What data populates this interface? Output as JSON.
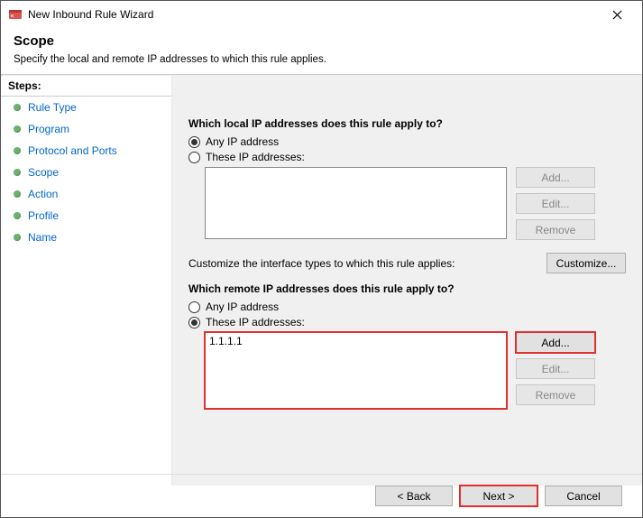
{
  "window": {
    "title": "New Inbound Rule Wizard"
  },
  "header": {
    "title": "Scope",
    "subtitle": "Specify the local and remote IP addresses to which this rule applies."
  },
  "sidebar": {
    "header": "Steps:",
    "items": [
      {
        "label": "Rule Type"
      },
      {
        "label": "Program"
      },
      {
        "label": "Protocol and Ports"
      },
      {
        "label": "Scope"
      },
      {
        "label": "Action"
      },
      {
        "label": "Profile"
      },
      {
        "label": "Name"
      }
    ]
  },
  "local": {
    "question": "Which local IP addresses does this rule apply to?",
    "optAny": "Any IP address",
    "optThese": "These IP addresses:",
    "addBtn": "Add...",
    "editBtn": "Edit...",
    "removeBtn": "Remove"
  },
  "customize": {
    "text": "Customize the interface types to which this rule applies:",
    "btn": "Customize..."
  },
  "remote": {
    "question": "Which remote IP addresses does this rule apply to?",
    "optAny": "Any IP address",
    "optThese": "These IP addresses:",
    "ips": [
      "1.1.1.1"
    ],
    "addBtn": "Add...",
    "editBtn": "Edit...",
    "removeBtn": "Remove"
  },
  "footer": {
    "back": "< Back",
    "next": "Next >",
    "cancel": "Cancel"
  }
}
